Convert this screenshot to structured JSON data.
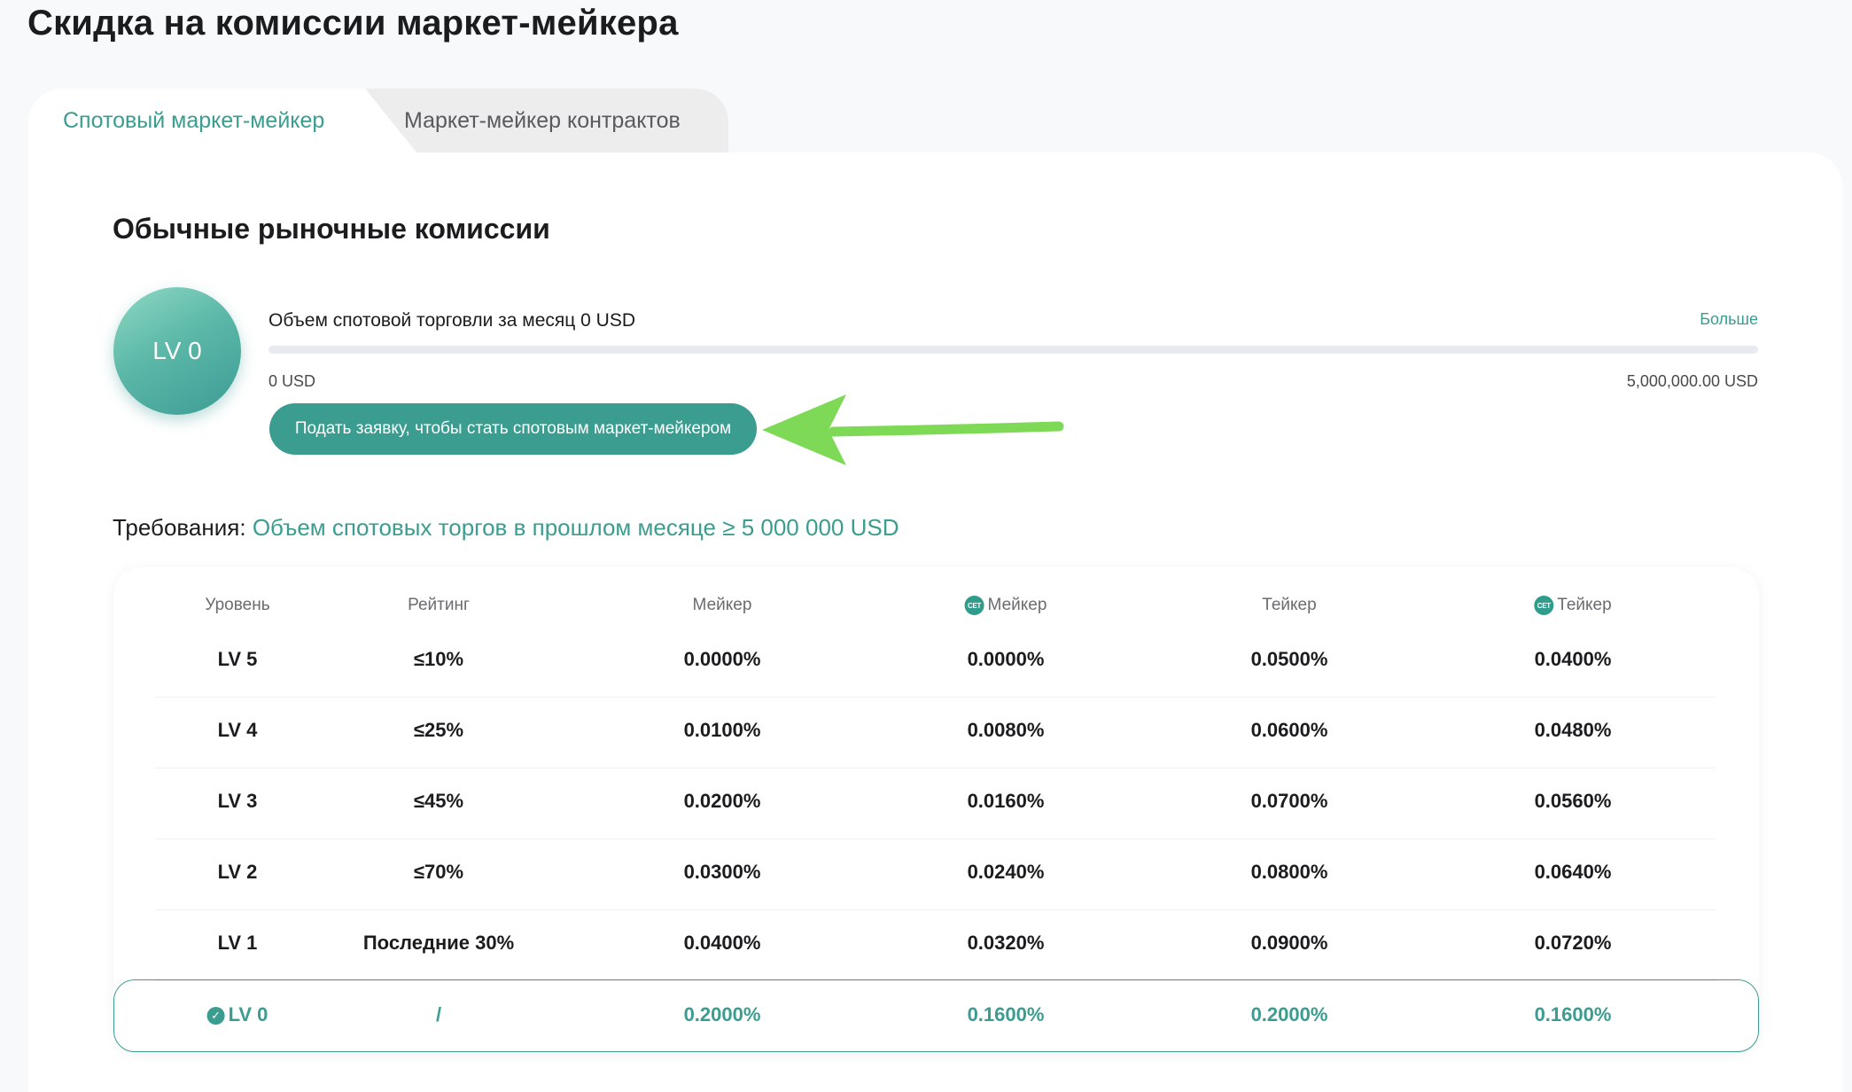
{
  "page_title": "Скидка на комиссии маркет-мейкера",
  "tabs": [
    {
      "label": "Спотовый маркет-мейкер",
      "active": true
    },
    {
      "label": "Маркет-мейкер контрактов",
      "active": false
    }
  ],
  "section_title": "Обычные рыночные комиссии",
  "level_badge": "LV 0",
  "volume_text": "Объем спотовой торговли за месяц 0 USD",
  "more_link": "Больше",
  "progress": {
    "value_fraction": 0,
    "min_label": "0 USD",
    "max_label": "5,000,000.00 USD"
  },
  "apply_button": "Подать заявку, чтобы стать спотовым маркет-мейкером",
  "requirements": {
    "label": "Требования:",
    "value": "Объем спотовых торгов в прошлом месяце ≥ 5 000 000 USD"
  },
  "table": {
    "headers": [
      "Уровень",
      "Рейтинг",
      "Мейкер",
      "Мейкер",
      "Тейкер",
      "Тейкер"
    ],
    "header_icon": "CET",
    "rows": [
      [
        "LV 5",
        "≤10%",
        "0.0000%",
        "0.0000%",
        "0.0500%",
        "0.0400%"
      ],
      [
        "LV 4",
        "≤25%",
        "0.0100%",
        "0.0080%",
        "0.0600%",
        "0.0480%"
      ],
      [
        "LV 3",
        "≤45%",
        "0.0200%",
        "0.0160%",
        "0.0700%",
        "0.0560%"
      ],
      [
        "LV 2",
        "≤70%",
        "0.0300%",
        "0.0240%",
        "0.0800%",
        "0.0640%"
      ],
      [
        "LV 1",
        "Последние 30%",
        "0.0400%",
        "0.0320%",
        "0.0900%",
        "0.0720%"
      ]
    ],
    "current_row": [
      "LV 0",
      "/",
      "0.2000%",
      "0.1600%",
      "0.2000%",
      "0.1600%"
    ]
  },
  "colors": {
    "accent": "#3a9d8f",
    "annotation_arrow": "#7ed957"
  }
}
